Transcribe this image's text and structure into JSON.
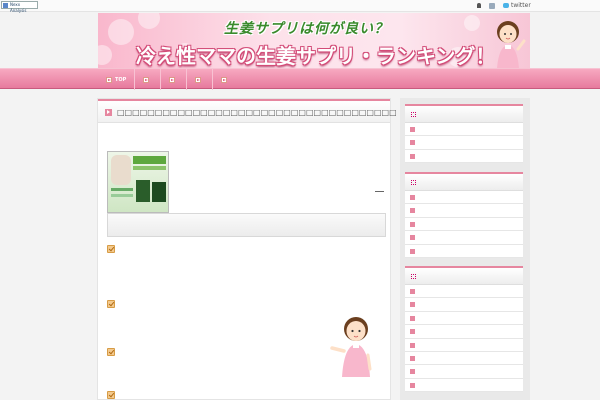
{
  "topbar": {
    "analysis_label": "Nexx Analysis",
    "twitter_label": "twitter"
  },
  "banner": {
    "subtitle": "生姜サプリは何が良い？",
    "title": "冷え性ママの生姜サプリ・ランキング！"
  },
  "nav": {
    "items": [
      "TOP",
      "",
      "",
      "",
      ""
    ]
  },
  "post": {
    "title": "□□□□□□□□□□□□□□□□□□□□□□□□□□□□□□□□□□□□□"
  },
  "sidebar": {
    "widgets": [
      {
        "rows": 3
      },
      {
        "rows": 5
      },
      {
        "rows": 8
      }
    ]
  },
  "colors": {
    "accent_pink": "#e6869f",
    "nav_pink": "#ef8fad",
    "banner_green": "#3a8a2c"
  }
}
